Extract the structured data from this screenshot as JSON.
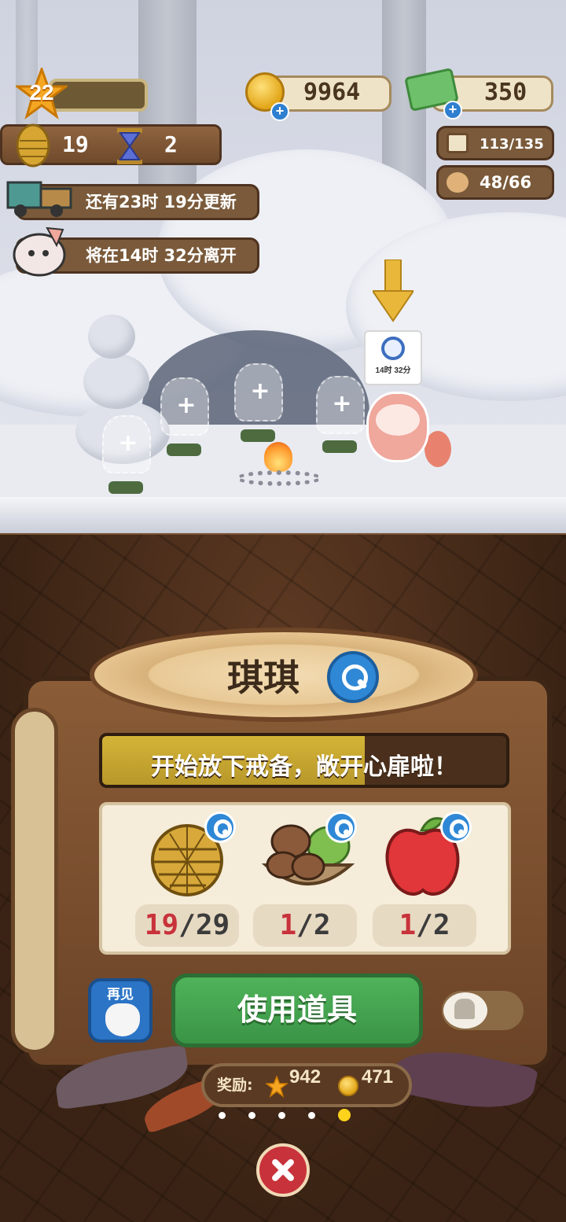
{
  "hud": {
    "level": "22",
    "pinecones": "19",
    "hourglass": "2",
    "coins": "9964",
    "cash": "350",
    "storage": "113/135",
    "visitors": "48/66"
  },
  "notices": {
    "truck_refresh": "还有23时 19分更新",
    "guest_leaving": "将在14时 32分离开"
  },
  "scene": {
    "timer_tag": "14时 32分"
  },
  "panel": {
    "character_name": "琪琪",
    "progress_text": "开始放下戒备，敞开心扉啦！",
    "progress_fraction": 0.65,
    "items": [
      {
        "name": "pinecone",
        "have": "19",
        "need": "/29"
      },
      {
        "name": "mushrooms",
        "have": "1",
        "need": "/2"
      },
      {
        "name": "apple",
        "have": "1",
        "need": "/2"
      }
    ],
    "bye_label": "再见",
    "use_item_label": "使用道具",
    "reward_label": "奖励:",
    "reward_stars": "942",
    "reward_coins": "471",
    "page_dots": 5,
    "active_dot": 5
  },
  "colors": {
    "accent_green": "#3a9446",
    "accent_blue": "#2f88d6",
    "close_red": "#c8323b",
    "count_red": "#c8323b"
  }
}
